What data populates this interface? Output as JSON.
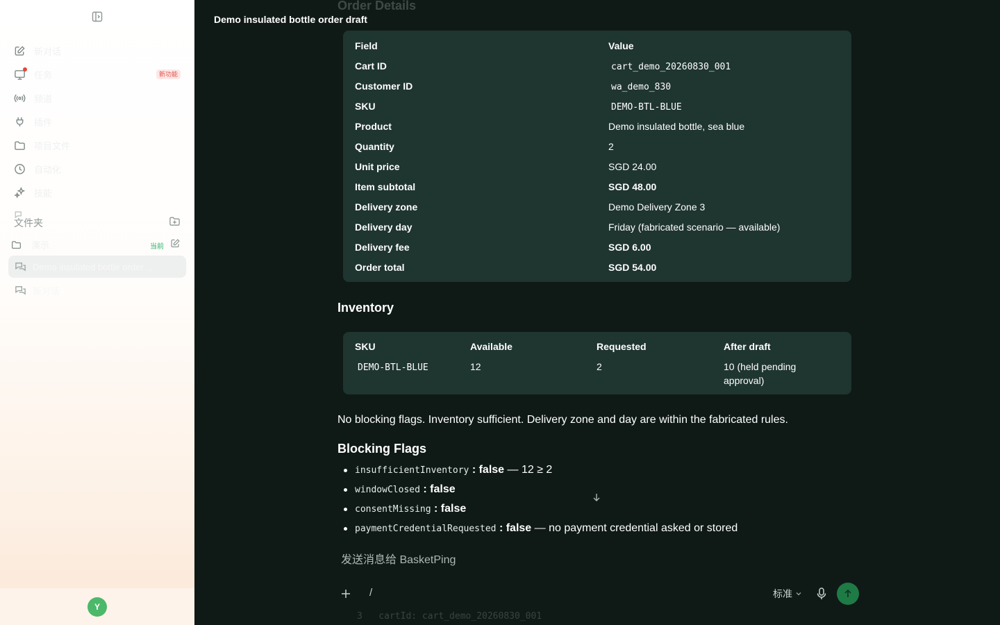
{
  "sidebar": {
    "nav": [
      {
        "label": "新对话",
        "icon": "edit-icon",
        "badge": ""
      },
      {
        "label": "任务",
        "icon": "monitor-icon",
        "badge": "新功能"
      },
      {
        "label": "频道",
        "icon": "broadcast-icon",
        "badge": ""
      },
      {
        "label": "插件",
        "icon": "plug-icon",
        "badge": ""
      },
      {
        "label": "项目文件",
        "icon": "folder-icon",
        "badge": ""
      },
      {
        "label": "自动化",
        "icon": "clock-icon",
        "badge": ""
      },
      {
        "label": "技能",
        "icon": "sparkles-icon",
        "badge": ""
      }
    ],
    "folders_title": "文件夹",
    "folder": {
      "label": "演示",
      "current": "当前"
    },
    "chats": [
      {
        "label": "Demo insulated bottle order ...",
        "active": true
      },
      {
        "label": "新对话",
        "active": false
      }
    ],
    "avatar_initial": "Y"
  },
  "main": {
    "ghost_heading": "Order Details",
    "chat_title": "Demo insulated bottle order draft",
    "details": {
      "headers": [
        "Field",
        "Value"
      ],
      "rows": [
        {
          "field": "Cart ID",
          "value": "cart_demo_20260830_001"
        },
        {
          "field": "Customer ID",
          "value": "wa_demo_830"
        },
        {
          "field": "SKU",
          "value": "DEMO-BTL-BLUE"
        },
        {
          "field": "Product",
          "value": "Demo insulated bottle, sea blue"
        },
        {
          "field": "Quantity",
          "value": "2"
        },
        {
          "field": "Unit price",
          "value": "SGD 24.00"
        },
        {
          "field": "Item subtotal",
          "value": "SGD 48.00"
        },
        {
          "field": "Delivery zone",
          "value": "Demo Delivery Zone 3"
        },
        {
          "field": "Delivery day",
          "value": "Friday (fabricated scenario — available)"
        },
        {
          "field": "Delivery fee",
          "value": "SGD 6.00"
        },
        {
          "field": "Order total",
          "value": "SGD 54.00"
        }
      ]
    },
    "inventory_heading": "Inventory",
    "inventory": {
      "headers": [
        "SKU",
        "Available",
        "Requested",
        "After draft"
      ],
      "row": {
        "sku": "DEMO-BTL-BLUE",
        "available": "12",
        "requested": "2",
        "after": "10 (held pending approval)"
      }
    },
    "summary": "No blocking flags. Inventory sufficient. Delivery zone and day are within the fabricated rules.",
    "flags_heading": "Blocking Flags",
    "flags": [
      {
        "code": "insufficientInventory",
        "sep": " : ",
        "value": "false",
        "note": " — 12 ≥ 2"
      },
      {
        "code": "windowClosed",
        "sep": " : ",
        "value": "false",
        "note": ""
      },
      {
        "code": "consentMissing",
        "sep": " : ",
        "value": "false",
        "note": ""
      },
      {
        "code": "paymentCredentialRequested",
        "sep": " : ",
        "value": "false",
        "note": " — no payment credential asked or stored"
      }
    ],
    "composer": {
      "placeholder": "发送消息给 BasketPing",
      "slash": "/",
      "mode": "标准"
    },
    "ghost_code": "3   cartId: cart_demo_20260830_001"
  }
}
